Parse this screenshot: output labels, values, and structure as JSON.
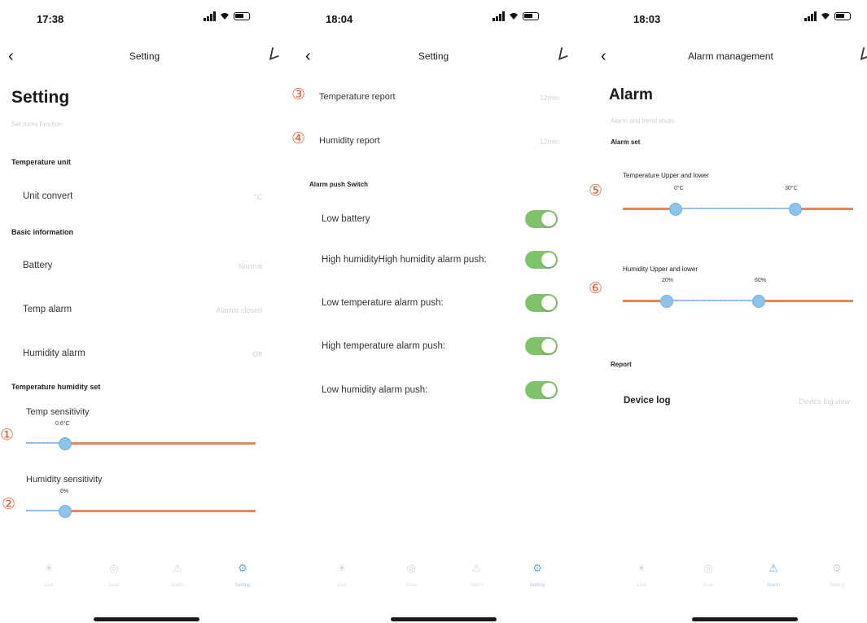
{
  "screens": [
    {
      "status": {
        "time": "17:38"
      },
      "nav": {
        "title": "Setting"
      },
      "page_title": "Setting",
      "subtitle": "Set more function",
      "sections": {
        "temp_unit": "Temperature unit",
        "basic_info": "Basic information",
        "th_set": "Temperature humidity set"
      },
      "rows": {
        "unit_convert": {
          "label": "Unit convert",
          "value": "°C"
        },
        "battery": {
          "label": "Battery",
          "value": "Normal"
        },
        "temp_alarm": {
          "label": "Temp alarm",
          "value": "Alarms closed"
        },
        "humidity_alarm": {
          "label": "Humidity alarm",
          "value": "Off"
        }
      },
      "sliders": {
        "temp_sensitivity": {
          "label": "Temp sensitivity",
          "value_text": "0.6°C",
          "marker": "①",
          "level": 0.17
        },
        "humidity_sensitivity": {
          "label": "Humidity sensitivity",
          "value_text": "6%",
          "marker": "②",
          "level": 0.17
        }
      },
      "tabs": [
        "Live",
        "Scan",
        "Alarm",
        "Setting"
      ],
      "active_tab": 3
    },
    {
      "status": {
        "time": "18:04"
      },
      "nav": {
        "title": "Setting"
      },
      "rows": {
        "temp_report": {
          "label": "Temperature report",
          "value": "12min",
          "marker": "③"
        },
        "humidity_report": {
          "label": "Humidity report",
          "value": "12min",
          "marker": "④"
        }
      },
      "alarm_push_section": "Alarm push Switch",
      "switches": [
        {
          "label": "Low battery",
          "on": true
        },
        {
          "label": "High humidityHigh humidity alarm push:",
          "on": true
        },
        {
          "label": "Low temperature alarm push:",
          "on": true
        },
        {
          "label": "High temperature alarm push:",
          "on": true
        },
        {
          "label": "Low humidity alarm push:",
          "on": true
        }
      ],
      "tabs": [
        "Live",
        "Scan",
        "Alarm",
        "Setting"
      ],
      "active_tab": 3
    },
    {
      "status": {
        "time": "18:03"
      },
      "nav": {
        "title": "Alarm management"
      },
      "page_title": "Alarm",
      "subtitle": "Alarm and trend shots",
      "alarm_set_section": "Alarm set",
      "temp_range": {
        "label": "Temperature Upper and lower",
        "low_text": "0°C",
        "high_text": "30°C",
        "marker": "⑤",
        "low": 0.23,
        "high": 0.75
      },
      "humidity_range": {
        "label": "Humidity Upper and lower",
        "low_text": "20%",
        "high_text": "60%",
        "marker": "⑥",
        "low": 0.19,
        "high": 0.59
      },
      "report_section": "Report",
      "device_log": {
        "label": "Device log",
        "value": "Device log view"
      },
      "tabs": [
        "Live",
        "Scan",
        "Alarm",
        "Setting"
      ],
      "active_tab": 2
    }
  ],
  "colors": {
    "accent_orange": "#e8855a",
    "accent_blue": "#8ec3ea",
    "toggle_green": "#7fc46a",
    "marker_red": "#e0603a"
  },
  "icons": {
    "back": "‹",
    "edit": "∠",
    "tab_icons": [
      "☀",
      "◎",
      "⚠",
      "⚙"
    ]
  }
}
